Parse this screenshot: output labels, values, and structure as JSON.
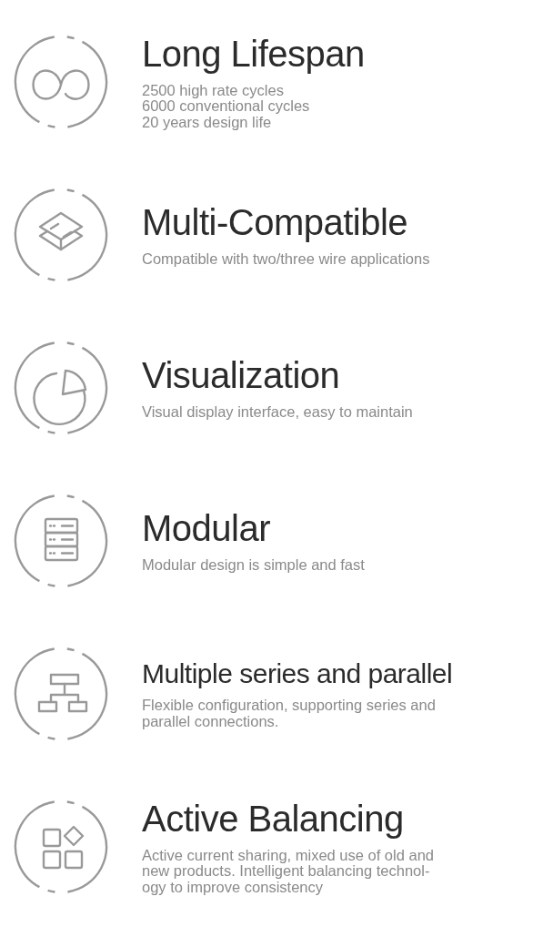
{
  "features": [
    {
      "kind": "infinity",
      "title": "Long Lifespan",
      "lines": [
        "2500 high rate cycles",
        "6000 conventional cycles",
        "20 years design life"
      ]
    },
    {
      "kind": "layers",
      "title": "Multi-Compatible",
      "lines": [
        "Compatible with two/three wire applications"
      ]
    },
    {
      "kind": "pie",
      "title": "Visualization",
      "lines": [
        "Visual display interface, easy to maintain"
      ]
    },
    {
      "kind": "server",
      "title": "Modular",
      "lines": [
        "Modular design is simple and fast"
      ]
    },
    {
      "kind": "hierarchy",
      "title": "Multiple series and parallel",
      "lines": [
        "Flexible configuration, supporting series and",
        "parallel connections."
      ]
    },
    {
      "kind": "blocks",
      "title": "Active Balancing",
      "lines": [
        "Active current sharing, mixed use of old and",
        "new products. Intelligent balancing technol-",
        "ogy to improve consistency"
      ]
    }
  ]
}
